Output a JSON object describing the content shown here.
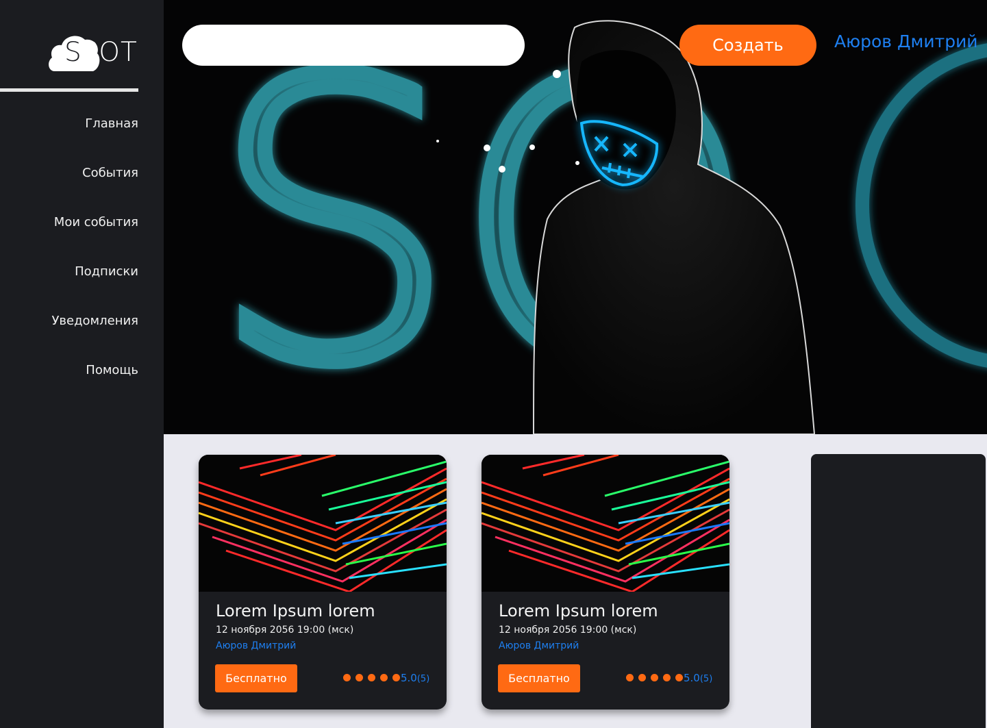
{
  "logo": {
    "letter": "S",
    "rest": "POT"
  },
  "nav": {
    "items": [
      {
        "label": "Главная"
      },
      {
        "label": "События"
      },
      {
        "label": "Мои события"
      },
      {
        "label": "Подписки"
      },
      {
        "label": "Уведомления"
      },
      {
        "label": "Помощь"
      }
    ]
  },
  "header": {
    "search_value": "",
    "create_label": "Создать",
    "user_name": "Аюров Дмитрий"
  },
  "hero": {
    "decor_text": "SO"
  },
  "events": [
    {
      "title": "Lorem Ipsum lorem",
      "date": "12 ноября 2056 19:00 (мск)",
      "author": "Аюров Дмитрий",
      "price_label": "Бесплатно",
      "rating": "5.0",
      "reviews": "(5)"
    },
    {
      "title": "Lorem Ipsum lorem",
      "date": "12 ноября 2056 19:00 (мск)",
      "author": "Аюров Дмитрий",
      "price_label": "Бесплатно",
      "rating": "5.0",
      "reviews": "(5)"
    }
  ],
  "colors": {
    "sidebar": "#1b1c20",
    "accent_orange": "#ff6a13",
    "accent_blue": "#1e7ff0",
    "neon_teal": "#2a8a96",
    "content_bg": "#e9e9f0"
  },
  "icons": [
    "cloud-logo-icon",
    "rating-dot-icon"
  ]
}
